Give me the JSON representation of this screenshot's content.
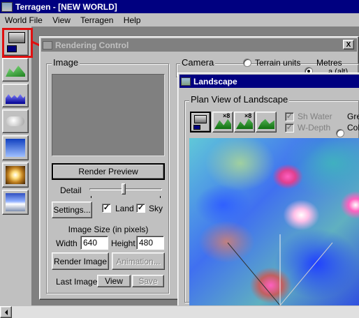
{
  "app": {
    "title": "Terragen  -  [NEW WORLD]"
  },
  "menu": {
    "world_file": "World File",
    "view": "View",
    "terragen": "Terragen",
    "help": "Help"
  },
  "render_window": {
    "title": "Rendering Control",
    "image_group": "Image",
    "render_preview": "Render Preview",
    "detail_label": "Detail",
    "detail_value": 0.45,
    "settings": "Settings...",
    "land_label": "Land",
    "land_checked": true,
    "sky_label": "Sky",
    "sky_checked": true,
    "image_size_label": "Image Size (in pixels)",
    "width_label": "Width",
    "width_value": "640",
    "height_label": "Height",
    "height_value": "480",
    "render_image": "Render Image",
    "animation": "Animation...",
    "last_image_label": "Last Image:",
    "view": "View",
    "save": "Save",
    "camera_group": "Camera",
    "terrain_units": "Terrain units",
    "metres": "Metres",
    "alt_label": "a (alt)",
    "close": "X"
  },
  "landscape_window": {
    "title": "Landscape",
    "plan_view_label": "Plan View of Landscape",
    "sh_water": "Sh Water",
    "w_depth": "W-Depth",
    "gre": "Gre",
    "col": "Col",
    "tool_x8_a": "×8",
    "tool_x8_b": "×8"
  },
  "colors": {
    "titlebar_active": "#000080",
    "titlebar_inactive": "#808080",
    "highlight": "#e01010"
  }
}
